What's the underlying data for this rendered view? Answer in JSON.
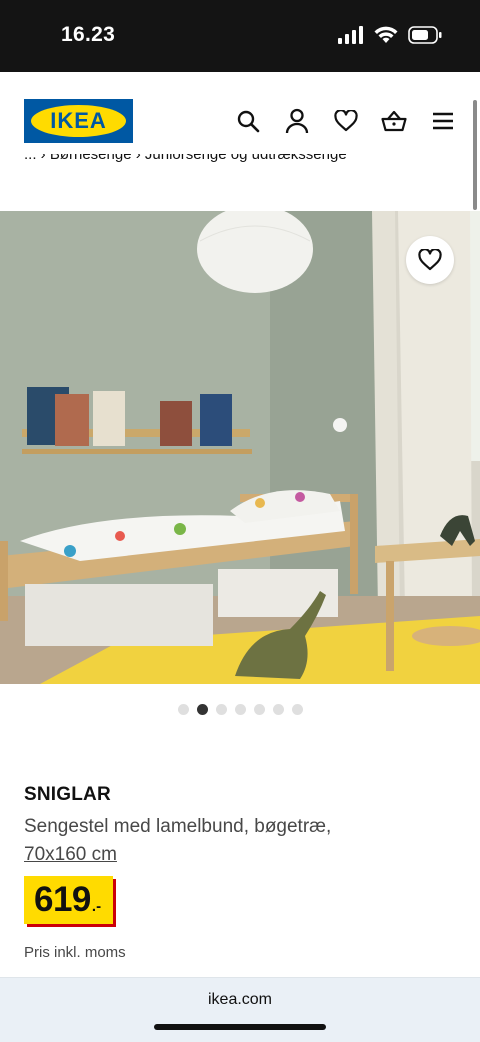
{
  "status_bar": {
    "time": "16.23"
  },
  "header": {
    "logo": "IKEA",
    "icons": [
      "search-icon",
      "account-icon",
      "heart-icon",
      "basket-icon",
      "menu-icon"
    ]
  },
  "breadcrumb": {
    "text": "... › Børnesenge › Juniorsenge og udtrækssenge"
  },
  "gallery": {
    "slides_total": 7,
    "active_slide_index": 1
  },
  "product": {
    "name": "SNIGLAR",
    "description": "Sengestel med lamelbund, bøgetræ,",
    "size": "70x160 cm",
    "price_integer": "619",
    "price_decimal": ".-",
    "price_note": "Pris inkl. moms"
  },
  "browser": {
    "url": "ikea.com"
  },
  "colors": {
    "ikea_blue": "#0058a3",
    "ikea_yellow": "#ffdb00",
    "price_shadow": "#cc0008"
  }
}
